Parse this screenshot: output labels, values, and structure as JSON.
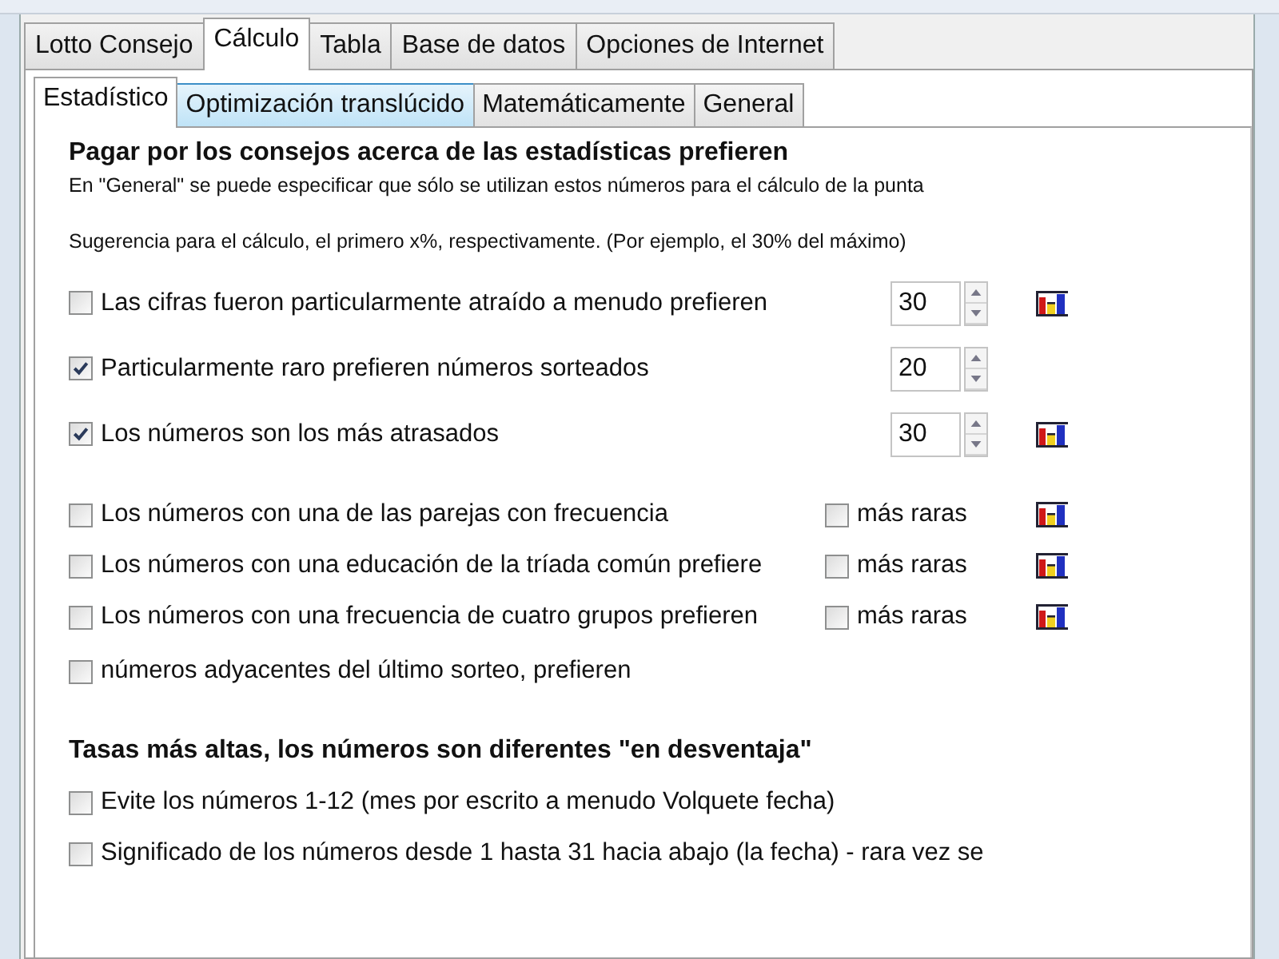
{
  "tabs": [
    {
      "label": "Lotto Consejo",
      "selected": false
    },
    {
      "label": "Cálculo",
      "selected": true
    },
    {
      "label": "Tabla",
      "selected": false
    },
    {
      "label": "Base de datos",
      "selected": false
    },
    {
      "label": "Opciones de Internet",
      "selected": false
    }
  ],
  "subtabs": [
    {
      "label": "Estadístico",
      "selected": true,
      "hovered": false
    },
    {
      "label": "Optimización translúcido",
      "selected": false,
      "hovered": true
    },
    {
      "label": "Matemáticamente",
      "selected": false,
      "hovered": false
    },
    {
      "label": "General",
      "selected": false,
      "hovered": false
    }
  ],
  "statistics": {
    "heading": "Pagar por los consejos acerca de las estadísticas prefieren",
    "note": "En \"General\" se puede especificar que sólo se utilizan estos números para el cálculo de la punta",
    "hint": "Sugerencia para el cálculo, el primero x%, respectivamente. (Por ejemplo, el 30% del máximo)",
    "options": [
      {
        "kind": "spin",
        "label": "Las cifras fueron particularmente atraído a menudo prefieren",
        "checked": false,
        "value": "30",
        "chart_button": true
      },
      {
        "kind": "spin",
        "label": "Particularmente raro prefieren números sorteados",
        "checked": true,
        "value": "20",
        "chart_button": false
      },
      {
        "kind": "spin",
        "label": "Los números son los más atrasados",
        "checked": true,
        "value": "30",
        "chart_button": true
      },
      {
        "kind": "rarer",
        "label": "Los números con una de las parejas con frecuencia",
        "checked": false,
        "rarer_label": "más raras",
        "rarer_checked": false,
        "chart_button": true
      },
      {
        "kind": "rarer",
        "label": "Los números con una educación de la tríada común prefiere",
        "checked": false,
        "rarer_label": "más raras",
        "rarer_checked": false,
        "chart_button": true
      },
      {
        "kind": "rarer",
        "label": "Los números con una frecuencia de cuatro grupos prefieren",
        "checked": false,
        "rarer_label": "más raras",
        "rarer_checked": false,
        "chart_button": true
      },
      {
        "kind": "plain",
        "label": "números adyacentes del último sorteo, prefieren",
        "checked": false
      }
    ]
  },
  "disadvantage": {
    "heading": "Tasas más altas, los números son diferentes \"en desventaja\"",
    "options": [
      {
        "kind": "plain",
        "label": "Evite los números 1-12 (mes por escrito a menudo Volquete fecha)",
        "checked": false
      },
      {
        "kind": "plain",
        "label": "Significado de los números desde 1 hasta 31 hacia abajo (la fecha) - rara vez se",
        "checked": false
      }
    ]
  }
}
